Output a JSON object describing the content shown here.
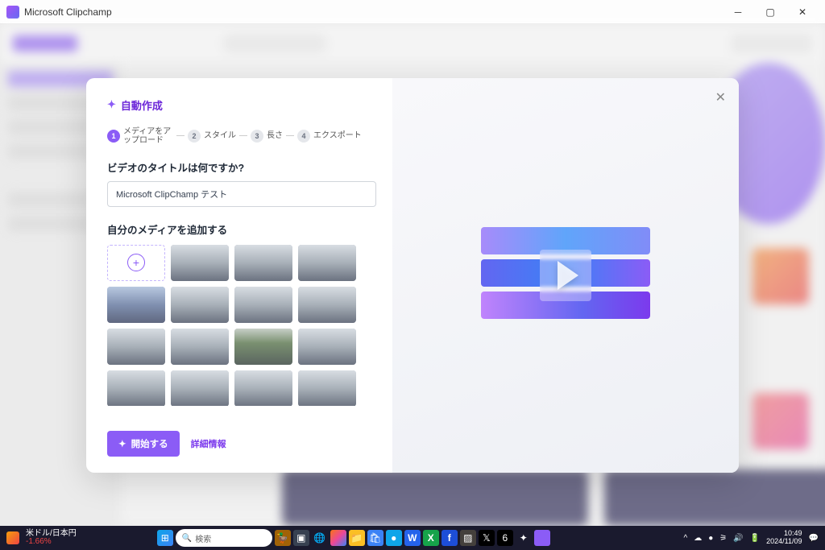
{
  "window": {
    "title": "Microsoft Clipchamp"
  },
  "modal": {
    "autoCreateLabel": "自動作成",
    "closeLabel": "×",
    "steps": [
      {
        "num": "1",
        "label": "メディアをアップロード",
        "active": true
      },
      {
        "num": "2",
        "label": "スタイル",
        "active": false
      },
      {
        "num": "3",
        "label": "長さ",
        "active": false
      },
      {
        "num": "4",
        "label": "エクスポート",
        "active": false
      }
    ],
    "titleQuestion": "ビデオのタイトルは何ですか?",
    "titleValue": "Microsoft ClipChamp テスト",
    "addMediaLabel": "自分のメディアを追加する",
    "startLabel": "開始する",
    "detailsLabel": "詳細情報"
  },
  "taskbar": {
    "widget": {
      "line1": "米ドル/日本円",
      "line2": "-1.66%"
    },
    "searchPlaceholder": "検索",
    "time": "10:49",
    "date": "2024/11/09"
  }
}
